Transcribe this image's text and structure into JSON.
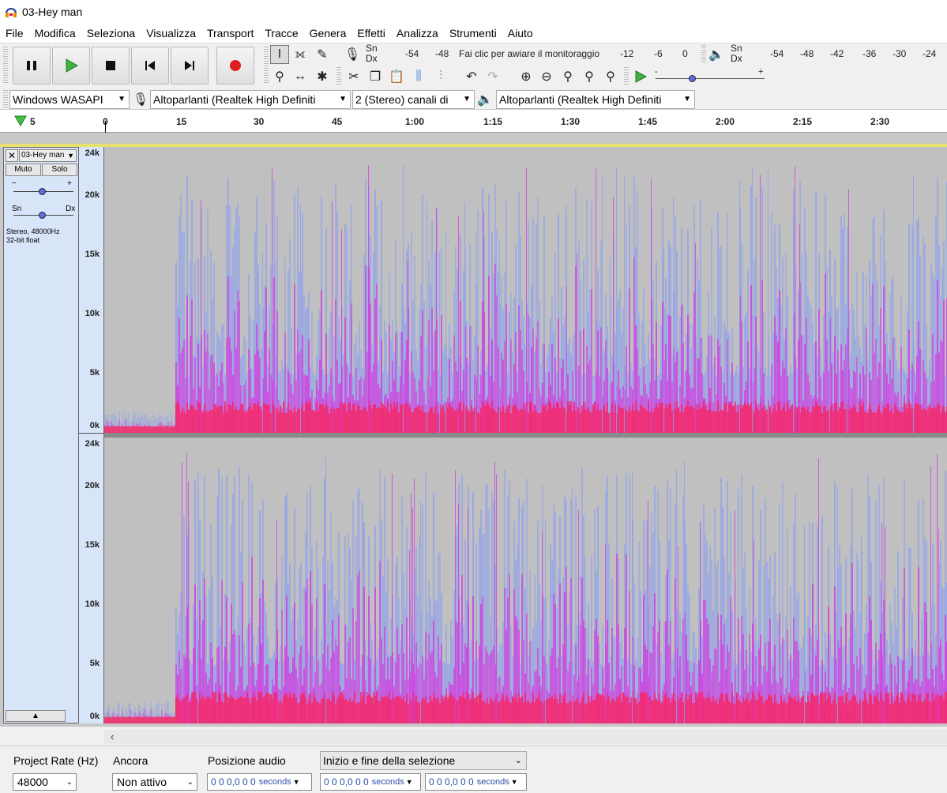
{
  "window": {
    "title": "03-Hey man"
  },
  "menu": [
    "File",
    "Modifica",
    "Seleziona",
    "Visualizza",
    "Transport",
    "Tracce",
    "Genera",
    "Effetti",
    "Analizza",
    "Strumenti",
    "Aiuto"
  ],
  "meters": {
    "rec_channels": "Sn\nDx",
    "rec_scale": [
      "-54",
      "-48",
      "-12",
      "-6",
      "0"
    ],
    "rec_hint": "Fai clic per awiare il monitoraggio",
    "play_channels": "Sn\nDx",
    "play_scale": [
      "-54",
      "-48",
      "-42",
      "-36",
      "-30",
      "-24"
    ]
  },
  "devices": {
    "host": "Windows WASAPI",
    "input": "Altoparlanti (Realtek High Definiti",
    "channels": "2 (Stereo) canali di",
    "output": "Altoparlanti (Realtek High Definiti"
  },
  "ruler": {
    "ticks": [
      "5",
      "0",
      "15",
      "30",
      "45",
      "1:00",
      "1:15",
      "1:30",
      "1:45",
      "2:00",
      "2:15",
      "2:30"
    ]
  },
  "track": {
    "name": "03-Hey man",
    "mute": "Muto",
    "solo": "Solo",
    "gain_minus": "−",
    "gain_plus": "+",
    "pan_left": "Sn",
    "pan_right": "Dx",
    "info_rate": "Stereo, 48000Hz",
    "info_format": "32-bit float"
  },
  "freq_axis": [
    "24k",
    "20k",
    "15k",
    "10k",
    "5k",
    "0k"
  ],
  "colors": {
    "spectrogram_bg": "#c0c0c0",
    "low": "#8c9ff0",
    "mid": "#d040e0",
    "high": "#ff2050",
    "track_bg": "#d8e4f8"
  },
  "status": {
    "rate_label": "Project Rate (Hz)",
    "rate_value": "48000",
    "snap_label": "Ancora",
    "snap_value": "Non attivo",
    "pos_label": "Posizione audio",
    "pos_value": "0 0 0,0 0 0",
    "pos_unit": "seconds",
    "sel_label": "Inizio e fine della selezione",
    "sel_start": "0 0 0,0 0 0",
    "sel_start_unit": "seconds",
    "sel_end": "0 0 0,0 0 0",
    "sel_end_unit": "seconds"
  }
}
